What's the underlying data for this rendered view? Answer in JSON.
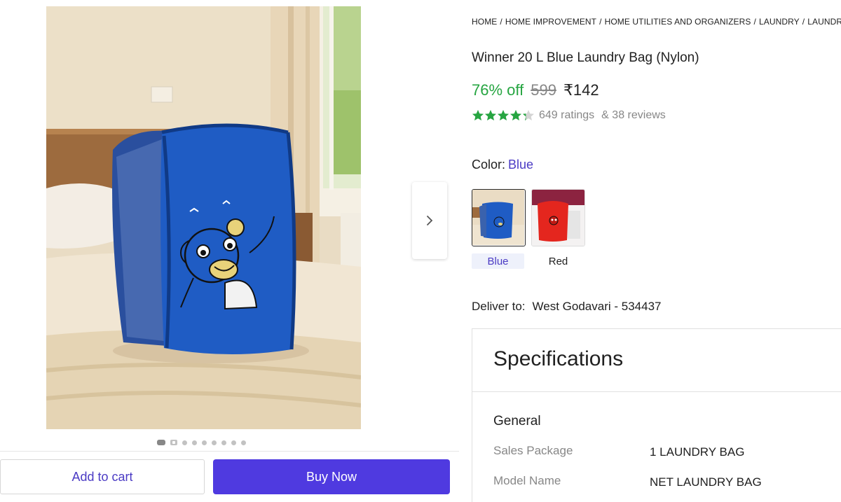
{
  "gallery": {
    "dot_count": 9,
    "active_dot": 0
  },
  "actions": {
    "add_to_cart": "Add to cart",
    "buy_now": "Buy Now"
  },
  "breadcrumb": [
    "HOME",
    "HOME IMPROVEMENT",
    "HOME UTILITIES AND ORGANIZERS",
    "LAUNDRY",
    "LAUNDRY"
  ],
  "product": {
    "title": "Winner 20 L Blue Laundry Bag (Nylon)",
    "discount": "76% off",
    "mrp": "599",
    "price": "₹142",
    "rating": 4.3,
    "ratings_count": "649 ratings",
    "reviews_count": "& 38 reviews"
  },
  "color": {
    "label": "Color:",
    "selected": "Blue",
    "options": [
      {
        "label": "Blue"
      },
      {
        "label": "Red"
      }
    ]
  },
  "delivery": {
    "label": "Deliver to:",
    "location": "West Godavari - 534437"
  },
  "specifications": {
    "title": "Specifications",
    "group": "General",
    "rows": [
      {
        "key": "Sales Package",
        "value": "1 LAUNDRY BAG"
      },
      {
        "key": "Model Name",
        "value": "NET LAUNDRY BAG"
      }
    ]
  },
  "colors": {
    "accent": "#4f3ae0",
    "link": "#4b3bc4",
    "green": "#26a541",
    "muted": "#878787"
  }
}
